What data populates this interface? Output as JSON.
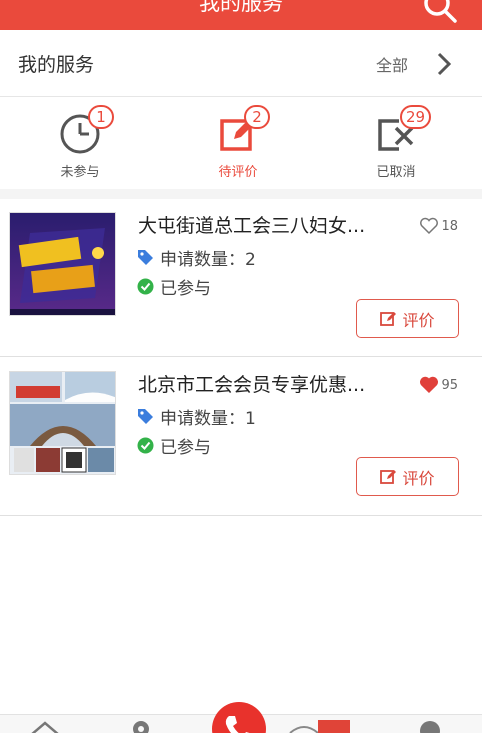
{
  "topbar": {
    "title": "我的服务",
    "search_icon": "search-icon"
  },
  "services": {
    "label": "我的服务",
    "all_label": "全部"
  },
  "tabs": [
    {
      "label": "未参与",
      "count": "1",
      "icon": "clock-icon"
    },
    {
      "label": "待评价",
      "count": "2",
      "icon": "edit-icon",
      "active": true
    },
    {
      "label": "已取消",
      "count": "29",
      "icon": "cancel-icon"
    }
  ],
  "cards": [
    {
      "title": "大屯街道总工会三八妇女...",
      "likes": "18",
      "liked": false,
      "apply_label": "申请数量：2",
      "status": "已参与",
      "button": "评价"
    },
    {
      "title": "北京市工会会员专享优惠...",
      "likes": "95",
      "liked": true,
      "apply_label": "申请数量：1",
      "status": "已参与",
      "button": "评价"
    }
  ],
  "colors": {
    "accent": "#ea4a3c",
    "tag_blue": "#3b7ddd",
    "status_green": "#33b249"
  }
}
